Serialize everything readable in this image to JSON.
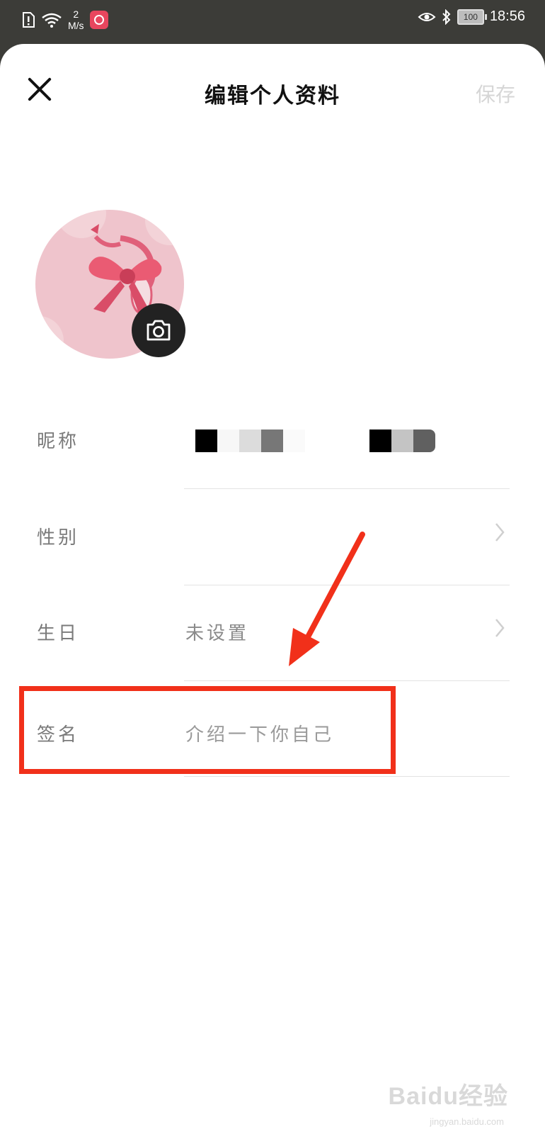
{
  "status_bar": {
    "net_speed_value": "2",
    "net_speed_unit": "M/s",
    "battery": "100",
    "time": "18:56"
  },
  "header": {
    "title": "编辑个人资料",
    "save_label": "保存"
  },
  "form": {
    "nickname_label": "昵称",
    "gender_label": "性别",
    "birthday_label": "生日",
    "birthday_value": "未设置",
    "signature_label": "签名",
    "signature_placeholder": "介绍一下你自己"
  },
  "watermark": {
    "text": "Baidu经验",
    "sub": "jingyan.baidu.com"
  },
  "colors": {
    "highlight": "#f1301a",
    "avatar_bg": "#efc4cc",
    "bow": "#e8556c"
  },
  "icons": {
    "close": "close-icon",
    "camera": "camera-icon",
    "chevron": "chevron-right-icon"
  }
}
